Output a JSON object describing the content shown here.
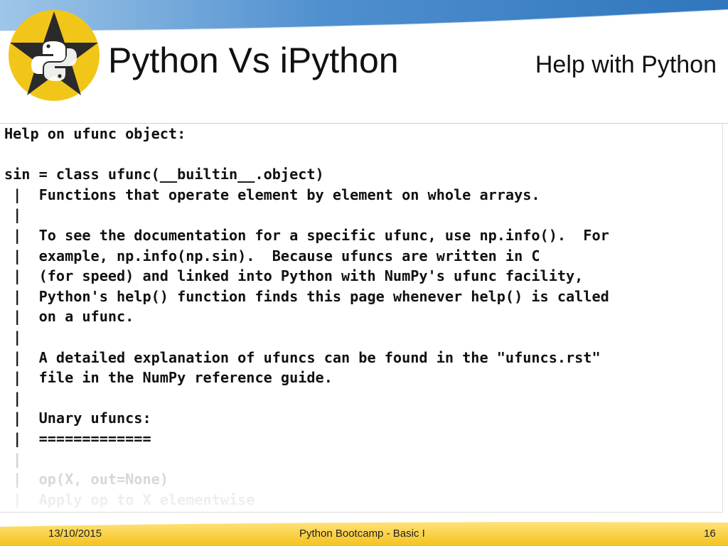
{
  "header": {
    "title": "Python Vs iPython",
    "subtitle": "Help with Python"
  },
  "code": {
    "lines": [
      "Help on ufunc object:",
      "",
      "sin = class ufunc(__builtin__.object)",
      " |  Functions that operate element by element on whole arrays.",
      " |",
      " |  To see the documentation for a specific ufunc, use np.info().  For",
      " |  example, np.info(np.sin).  Because ufuncs are written in C",
      " |  (for speed) and linked into Python with NumPy's ufunc facility,",
      " |  Python's help() function finds this page whenever help() is called",
      " |  on a ufunc.",
      " |",
      " |  A detailed explanation of ufuncs can be found in the \"ufuncs.rst\"",
      " |  file in the NumPy reference guide.",
      " |",
      " |  Unary ufuncs:",
      " |  =============",
      " |",
      " |  op(X, out=None)",
      " |  Apply op to X elementwise"
    ]
  },
  "footer": {
    "date": "13/10/2015",
    "center": "Python Bootcamp - Basic I",
    "page_number": "16"
  },
  "colors": {
    "band_light": "#9ec6e8",
    "band_dark": "#2f76bd",
    "logo_circle": "#f2c619",
    "logo_star": "#2a2a2a"
  },
  "icons": {
    "logo": "python-star-logo"
  }
}
